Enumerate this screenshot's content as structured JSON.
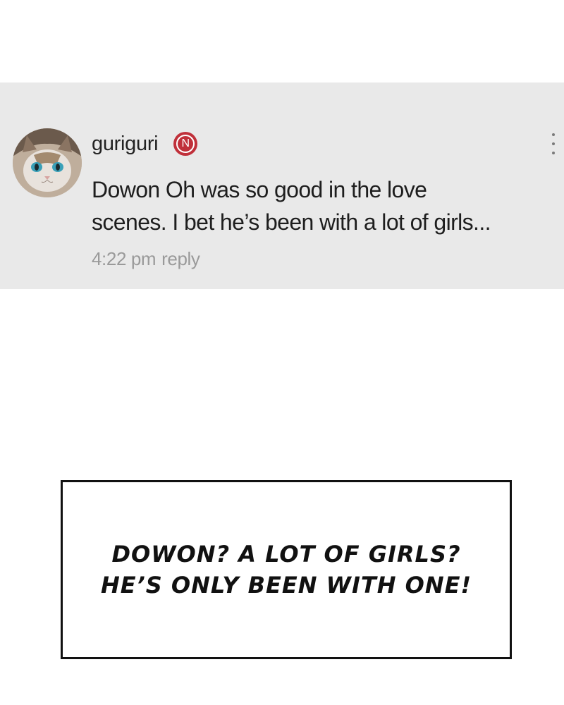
{
  "comment": {
    "username": "guriguri",
    "badge": "N",
    "text_line1": "Dowon Oh was so good in the love",
    "text_line2": "scenes. I bet he’s been with a lot of girls...",
    "time": "4:22 pm",
    "reply_label": "reply",
    "avatar_icon": "cat-avatar-icon",
    "more_icon": "more-vertical-icon",
    "badge_color": "#c0303a",
    "card_background": "#e9e9e9"
  },
  "caption": {
    "line1": "DOWON? A LOT OF GIRLS?",
    "line2": "HE’S ONLY BEEN WITH ONE!"
  }
}
